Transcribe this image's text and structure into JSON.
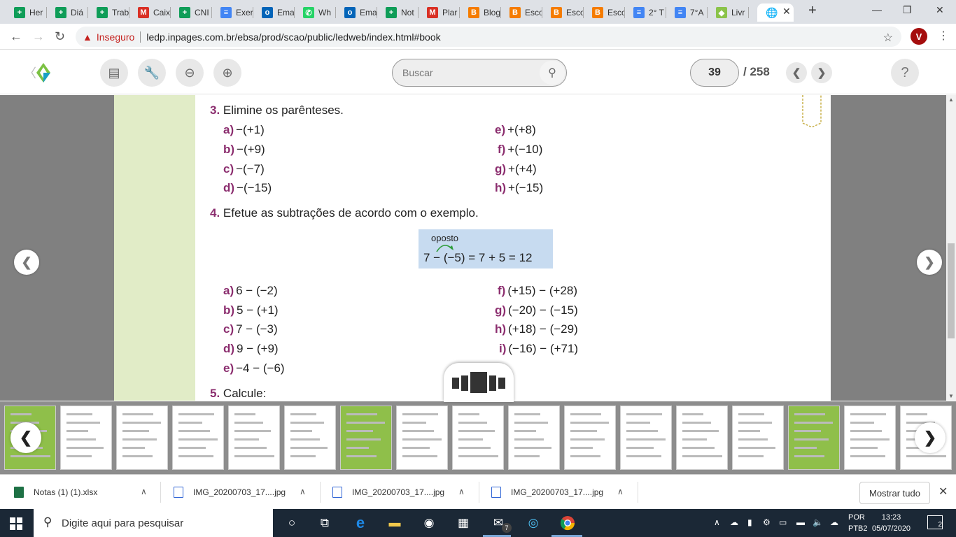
{
  "browser": {
    "tabs": [
      {
        "title": "Her",
        "color": "#0f9d58",
        "glyph": "+"
      },
      {
        "title": "Diá",
        "color": "#0f9d58",
        "glyph": "+"
      },
      {
        "title": "Trab",
        "color": "#0f9d58",
        "glyph": "+"
      },
      {
        "title": "Caix",
        "color": "#d93025",
        "glyph": "M"
      },
      {
        "title": "CNI",
        "color": "#0f9d58",
        "glyph": "+"
      },
      {
        "title": "Exer",
        "color": "#4285f4",
        "glyph": "≡"
      },
      {
        "title": "Ema",
        "color": "#0364b8",
        "glyph": "o"
      },
      {
        "title": "Wh",
        "color": "#25d366",
        "glyph": "✆"
      },
      {
        "title": "Ema",
        "color": "#0364b8",
        "glyph": "o"
      },
      {
        "title": "Not",
        "color": "#0f9d58",
        "glyph": "+"
      },
      {
        "title": "Plar",
        "color": "#d93025",
        "glyph": "M"
      },
      {
        "title": "Blog",
        "color": "#f57c00",
        "glyph": "B"
      },
      {
        "title": "Esco",
        "color": "#f57c00",
        "glyph": "B"
      },
      {
        "title": "Esco",
        "color": "#f57c00",
        "glyph": "B"
      },
      {
        "title": "Esco",
        "color": "#f57c00",
        "glyph": "B"
      },
      {
        "title": "2° T",
        "color": "#4285f4",
        "glyph": "≡"
      },
      {
        "title": "7°A",
        "color": "#4285f4",
        "glyph": "≡"
      },
      {
        "title": "Livr",
        "color": "#8bc34a",
        "glyph": "◆"
      }
    ],
    "active_tab_glyph": "🌐",
    "close_glyph": "✕",
    "newtab_glyph": "+",
    "minimize": "—",
    "maximize": "❐",
    "close_window": "✕",
    "back": "←",
    "forward": "→",
    "reload": "↻",
    "warning": "▲",
    "insecure_label": "Inseguro",
    "url": "ledp.inpages.com.br/ebsa/prod/scao/public/ledweb/index.html#book",
    "star": "☆",
    "avatar_letter": "V",
    "menu": "⋮"
  },
  "reader": {
    "back_glyph": "〈",
    "search_placeholder": "Buscar",
    "search_icon": "⚲",
    "current_page": "39",
    "total_pages": "/ 258",
    "prev": "❮",
    "next": "❯",
    "help": "?",
    "tools": [
      "▤",
      "🔧",
      "⊖",
      "⊕"
    ],
    "left_arrow": "❮",
    "right_arrow": "❯"
  },
  "page": {
    "q3": {
      "num": "3.",
      "text": "Elimine os parênteses."
    },
    "q3_items": [
      {
        "letter": "a)",
        "expr": "−(+1)"
      },
      {
        "letter": "b)",
        "expr": "−(+9)"
      },
      {
        "letter": "c)",
        "expr": "−(−7)"
      },
      {
        "letter": "d)",
        "expr": "−(−15)"
      },
      {
        "letter": "e)",
        "expr": "+(+8)"
      },
      {
        "letter": "f)",
        "expr": "+(−10)"
      },
      {
        "letter": "g)",
        "expr": "+(+4)"
      },
      {
        "letter": "h)",
        "expr": "+(−15)"
      }
    ],
    "q4": {
      "num": "4.",
      "text": "Efetue as subtrações de acordo com o exemplo."
    },
    "example": {
      "label": "oposto",
      "equation": "7 − (−5) = 7 + 5 = 12"
    },
    "q4_items": [
      {
        "letter": "a)",
        "expr": "6 − (−2)"
      },
      {
        "letter": "b)",
        "expr": "5 − (+1)"
      },
      {
        "letter": "c)",
        "expr": "7 − (−3)"
      },
      {
        "letter": "d)",
        "expr": "9 − (+9)"
      },
      {
        "letter": "e)",
        "expr": "−4 − (−6)"
      },
      {
        "letter": "f)",
        "expr": "(+15) − (+28)"
      },
      {
        "letter": "g)",
        "expr": "(−20) − (−15)"
      },
      {
        "letter": "h)",
        "expr": "(+18) − (−29)"
      },
      {
        "letter": "i)",
        "expr": "(−16) − (+71)"
      }
    ],
    "q5": {
      "num": "5.",
      "text": "Calcule:"
    }
  },
  "thumbnails": {
    "count": 17,
    "left_arrow": "❮",
    "right_arrow": "❯"
  },
  "downloads": {
    "items": [
      {
        "name": "Notas (1) (1).xlsx"
      },
      {
        "name": "IMG_20200703_17....jpg"
      },
      {
        "name": "IMG_20200703_17....jpg"
      },
      {
        "name": "IMG_20200703_17....jpg"
      }
    ],
    "chevron": "∧",
    "show_all": "Mostrar tudo",
    "close": "✕"
  },
  "taskbar": {
    "search_placeholder": "Digite aqui para pesquisar",
    "search_glyph": "⚲",
    "lang_line1": "POR",
    "lang_line2": "PTB2",
    "time": "13:23",
    "date": "05/07/2020",
    "notifications": "2",
    "tray_up": "∧",
    "mail_badge": "7"
  }
}
